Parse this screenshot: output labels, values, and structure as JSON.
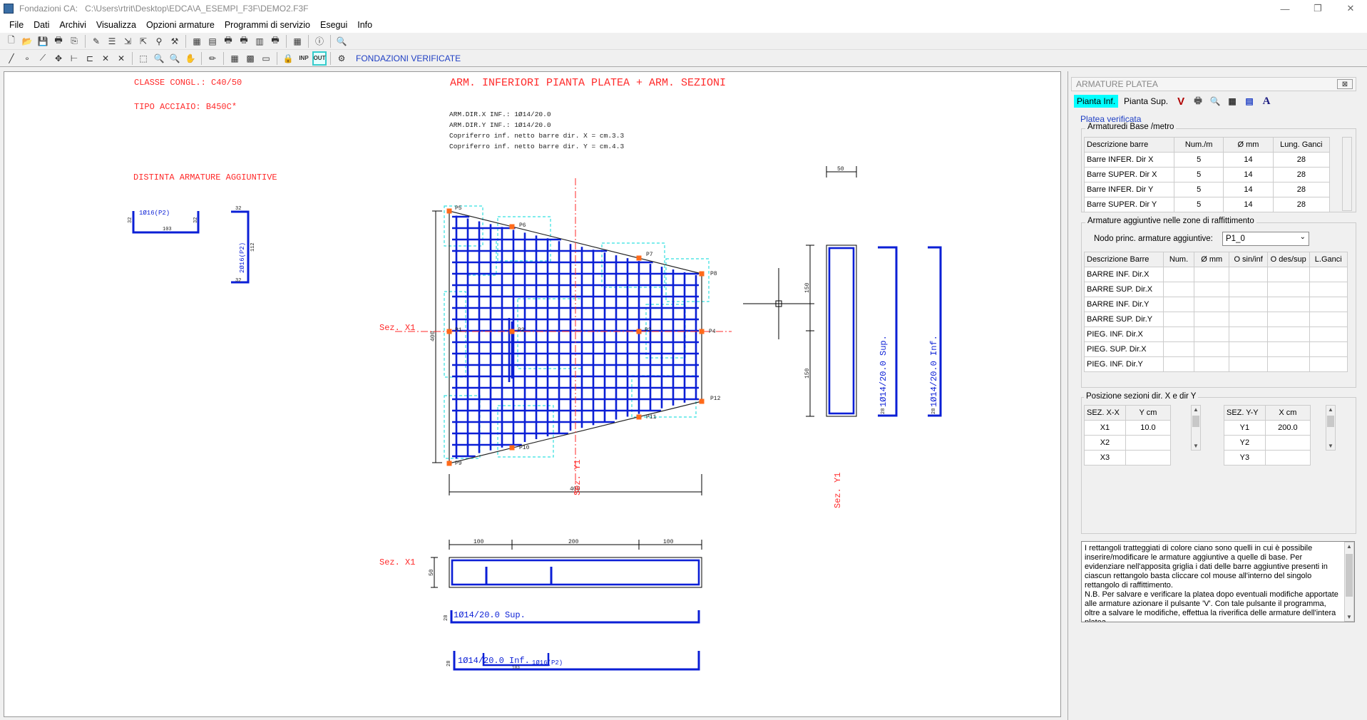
{
  "window": {
    "app_title": "Fondazioni CA:",
    "file_path": "C:\\Users\\rtrit\\Desktop\\EDCA\\A_ESEMPI_F3F\\DEMO2.F3F",
    "min_icon": "—",
    "max_icon": "❐",
    "close_icon": "✕"
  },
  "menu": [
    "File",
    "Dati",
    "Archivi",
    "Visualizza",
    "Opzioni armature",
    "Programmi di servizio",
    "Esegui",
    "Info"
  ],
  "toolbar": {
    "row1_icons": [
      "new-file-icon",
      "open-folder-icon",
      "save-icon",
      "print-icon",
      "copy-icon",
      "sep",
      "edit-icon",
      "stack-icon",
      "import-icon",
      "export-icon",
      "binoculars-icon",
      "tool-icon",
      "sep",
      "table-icon",
      "table2-icon",
      "printer-icon",
      "printer2-icon",
      "book-icon",
      "printer3-icon",
      "sep",
      "grid-icon",
      "sep",
      "info-icon",
      "sep",
      "search-icon"
    ],
    "row1_glyphs": [
      "🗋",
      "📂",
      "💾",
      "🖶",
      "⎘",
      "",
      "✎",
      "☰",
      "⇲",
      "⇱",
      "⚲",
      "⚒",
      "",
      "▦",
      "▤",
      "🖶",
      "🖶",
      "▥",
      "🖶",
      "",
      "▦",
      "",
      "ⓘ",
      "",
      "🔍"
    ],
    "row2_icons": [
      "line-icon",
      "point-icon",
      "polyline-icon",
      "move-icon",
      "dimension-icon",
      "dimension2-icon",
      "delete-icon",
      "delete2-icon",
      "sep",
      "zoom-window-icon",
      "zoom-out-icon",
      "zoom-in-icon",
      "pan-icon",
      "sep",
      "pencil-icon",
      "sep",
      "layers-icon",
      "colors-icon",
      "text-icon",
      "sep",
      "lock-icon",
      "inp-icon",
      "out-icon",
      "sep",
      "settings-icon"
    ],
    "row2_glyphs": [
      "╱",
      "∘",
      "⟋",
      "✥",
      "⊢",
      "⊏",
      "✕",
      "✕",
      "",
      "⬚",
      "🔍",
      "🔍",
      "✋",
      "",
      "✏",
      "",
      "▦",
      "▩",
      "▭",
      "",
      "🔒",
      "INP",
      "OUT",
      "",
      "⚙"
    ],
    "status_text": "FONDAZIONI VERIFICATE"
  },
  "drawing": {
    "classe": "CLASSE CONGL.: C40/50",
    "tipo": "TIPO  ACCIAIO: B450C*",
    "distinta": "DISTINTA ARMATURE AGGIUNTIVE",
    "main_title": "ARM. INFERIORI PIANTA PLATEA + ARM. SEZIONI",
    "notes": [
      "ARM.DIR.X INF.: 1Ø14/20.0",
      "ARM.DIR.Y INF.: 1Ø14/20.0",
      "Copriferro inf. netto barre dir. X = cm.3.3",
      "Copriferro inf. netto barre dir. Y = cm.4.3"
    ],
    "bar1_label": "1Ø16(P2)",
    "bar1_dims": [
      "32",
      "103",
      "32"
    ],
    "bar2_label": "2Ø16(P2)",
    "bar2_dims": [
      "32",
      "112",
      "32"
    ],
    "nodes": [
      "P5",
      "P6",
      "P7",
      "P8",
      "P1",
      "P2",
      "P3",
      "P4",
      "P12",
      "P11",
      "P10",
      "P9"
    ],
    "sez_x1": "Sez. X1",
    "sez_y1": "Sez. Y1",
    "dim_400_v": "400",
    "dim_400_h": "400",
    "dim_50_top": "50",
    "dim_150_a": "150",
    "dim_150_b": "150",
    "dim_100_a": "100",
    "dim_200": "200",
    "dim_100_b": "100",
    "dim_50_sec": "50",
    "dim_28_a": "28",
    "dim_28_b": "28",
    "dim_28_c": "28",
    "dim_28_d": "28",
    "sec_y_sup": "1Ø14/20.0 Sup.",
    "sec_y_inf": "1Ø14/20.0 Inf.",
    "sec_x_sup": "1Ø14/20.0 Sup.",
    "sec_x_inf": "1Ø14/20.0 Inf.",
    "sec_x_extra": "1Ø16(P2)",
    "sec_x_small": "103"
  },
  "panel": {
    "title": "ARMATURE PLATEA",
    "close": "⊠",
    "tab_inf": "Pianta Inf.",
    "tab_sup": "Pianta Sup.",
    "tab_icons": [
      "verify-v-icon",
      "print-icon",
      "preview-icon",
      "calculator-icon",
      "document-icon",
      "font-a-icon"
    ],
    "tab_glyphs": [
      "V",
      "🖶",
      "🔍",
      "▦",
      "▤",
      "A"
    ],
    "link": "Platea verificata",
    "base": {
      "label": "Armaturedi Base /metro",
      "headers": [
        "Descrizione barre",
        "Num./m",
        "Ø  mm",
        "Lung. Ganci"
      ],
      "rows": [
        [
          "Barre INFER. Dir X",
          "5",
          "14",
          "28"
        ],
        [
          "Barre SUPER. Dir X",
          "5",
          "14",
          "28"
        ],
        [
          "Barre INFER. Dir Y",
          "5",
          "14",
          "28"
        ],
        [
          "Barre SUPER. Dir Y",
          "5",
          "14",
          "28"
        ]
      ]
    },
    "extra": {
      "label": "Armature aggiuntive nelle zone di raffittimento",
      "node_label": "Nodo princ. armature aggiuntive:",
      "node_value": "P1_0",
      "headers": [
        "Descrizione Barre",
        "Num.",
        "Ø  mm",
        "O sin/inf",
        "O des/sup",
        "L.Ganci"
      ],
      "rows": [
        "BARRE INF. Dir.X",
        "BARRE SUP. Dir.X",
        "BARRE INF. Dir.Y",
        "BARRE SUP. Dir.Y",
        "PIEG. INF. Dir.X",
        "PIEG. SUP. Dir.X",
        "PIEG. INF. Dir.Y",
        "PIEG. SUP. Dir.Y"
      ]
    },
    "sections": {
      "label": "Posizione sezioni dir. X e dir Y",
      "x_headers": [
        "SEZ. X-X",
        "Y  cm"
      ],
      "x_rows": [
        [
          "X1",
          "10.0"
        ],
        [
          "X2",
          ""
        ],
        [
          "X3",
          ""
        ]
      ],
      "y_headers": [
        "SEZ. Y-Y",
        "X  cm"
      ],
      "y_rows": [
        [
          "Y1",
          "200.0"
        ],
        [
          "Y2",
          ""
        ],
        [
          "Y3",
          ""
        ]
      ]
    },
    "note": "I rettangoli tratteggiati di colore ciano sono quelli in cui è possibile inserire/modificare le armature aggiuntive a quelle di base. Per evidenziare nell'apposita griglia i dati delle barre aggiuntive presenti in ciascun rettangolo basta cliccare col mouse all'interno del singolo rettangolo di raffittimento.\nN.B.  Per salvare e verificare la platea dopo eventuali modifiche apportate alle armature azionare il pulsante 'V'. Con tale pulsante il programma, oltre a salvare le modifiche, effettua la riverifica delle armature dell'intera platea."
  },
  "colors": {
    "red": "#ff2a2a",
    "blue": "#0b1fd6",
    "cyan": "#33e0e0",
    "orange": "#ff6a1a",
    "dark": "#000000"
  }
}
